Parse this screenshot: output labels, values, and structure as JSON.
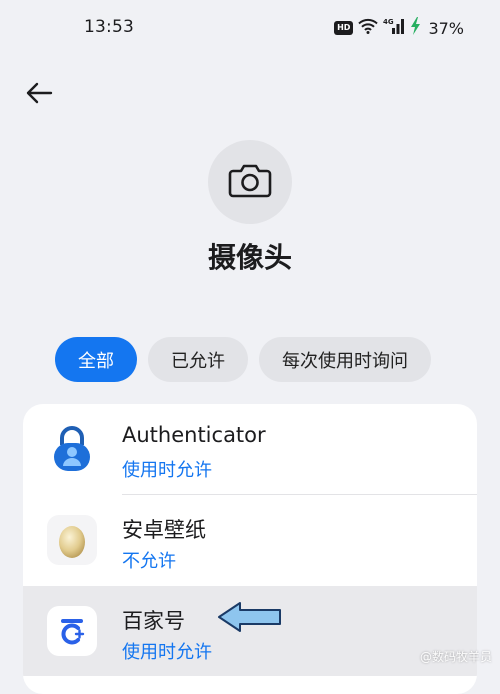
{
  "status_bar": {
    "time": "13:53",
    "hd_badge": "HD",
    "network": "4G",
    "battery": "37%"
  },
  "header": {
    "back_icon": "arrow-left-icon",
    "camera_icon": "camera-icon",
    "title": "摄像头"
  },
  "filters": [
    {
      "label": "全部",
      "active": true
    },
    {
      "label": "已允许",
      "active": false
    },
    {
      "label": "每次使用时询问",
      "active": false
    }
  ],
  "apps": [
    {
      "name": "Authenticator",
      "status": "使用时允许",
      "icon": "authenticator-lock-icon"
    },
    {
      "name": "安卓壁纸",
      "status": "不允许",
      "icon": "egg-wallpaper-icon"
    },
    {
      "name": "百家号",
      "status": "使用时允许",
      "icon": "baijiahao-icon"
    }
  ],
  "annotation": {
    "icon": "pointer-arrow-icon",
    "color": "#3b82c4"
  },
  "watermark": "@数码牧羊员",
  "colors": {
    "accent": "#1476f0",
    "background": "#f0f1f5"
  }
}
